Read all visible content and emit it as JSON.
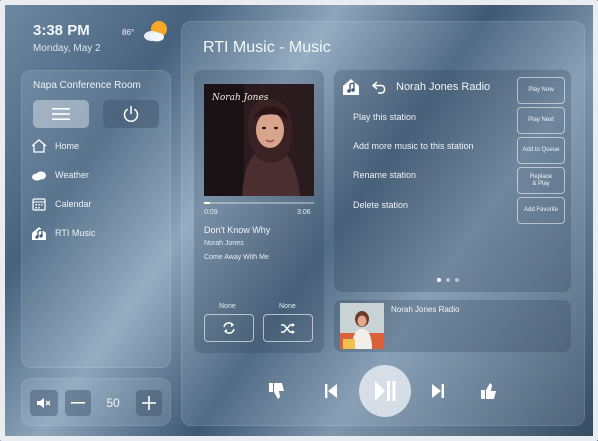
{
  "status": {
    "time": "3:38 PM",
    "date": "Monday, May 2",
    "temperature": "86°",
    "weather_icon": "partly-sunny-icon"
  },
  "sidebar": {
    "room": "Napa Conference Room",
    "items": [
      {
        "label": "Home",
        "icon": "home-icon"
      },
      {
        "label": "Weather",
        "icon": "cloud-icon"
      },
      {
        "label": "Calendar",
        "icon": "calendar-icon"
      },
      {
        "label": "RTI Music",
        "icon": "rti-music-icon"
      }
    ]
  },
  "volume": {
    "value": "50"
  },
  "main": {
    "title": "RTI Music - Music"
  },
  "now_playing": {
    "elapsed": "0:09",
    "duration": "3:06",
    "progress": 0.05,
    "song": "Don't Know Why",
    "artist": "Norah Jones",
    "album": "Come Away With Me",
    "album_art_text": "Norah Jones",
    "repeat_label": "None",
    "shuffle_label": "None"
  },
  "station": {
    "title": "Norah Jones Radio",
    "options": [
      "Play this station",
      "Add more music to this station",
      "Rename station",
      "Delete station"
    ],
    "actions": [
      "Play Now",
      "Play Next",
      "Add to Queue",
      "Replace\n& Play",
      "Add Favorite"
    ],
    "page_dots": 3,
    "active_dot": 0
  },
  "queue": {
    "title": "Norah Jones Radio"
  },
  "colors": {
    "accent": "#ffffff",
    "play_button": "#e4eaf0"
  }
}
